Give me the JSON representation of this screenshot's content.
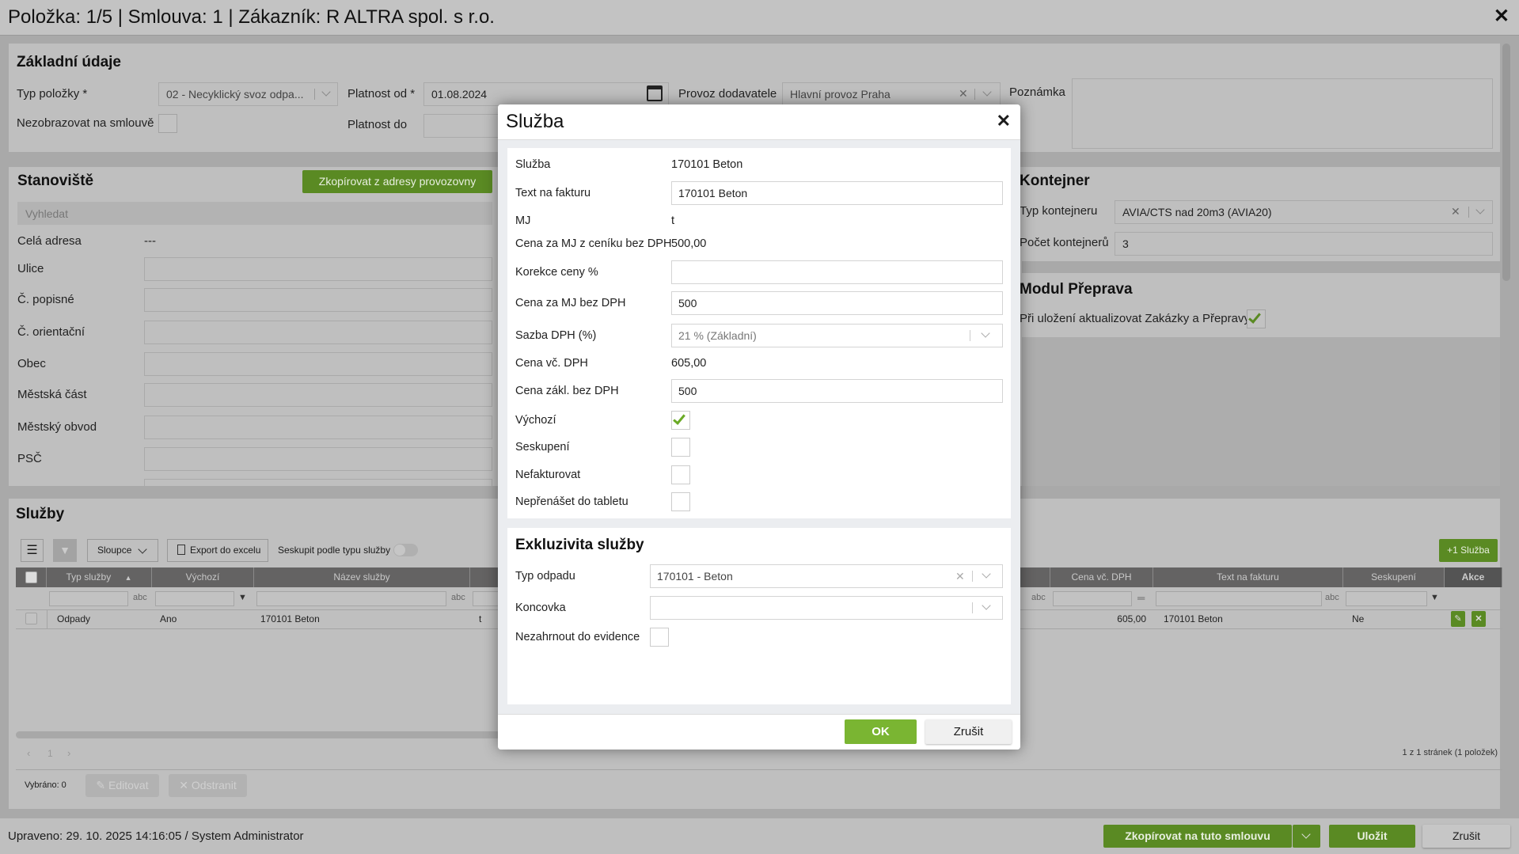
{
  "title": "Položka: 1/5 | Smlouva: 1 | Zákazník: R ALTRA spol. s r.o.",
  "basic": {
    "heading": "Základní údaje",
    "typ_label": "Typ položky *",
    "typ_value": "02 - Necyklický svoz odpa...",
    "nezobrazovat_label": "Nezobrazovat na smlouvě",
    "platnost_od_label": "Platnost od *",
    "platnost_od_value": "01.08.2024",
    "platnost_do_label": "Platnost do",
    "provoz_label": "Provoz dodavatele",
    "provoz_value": "Hlavní provoz Praha",
    "poznamka_label": "Poznámka"
  },
  "stanoviste": {
    "heading": "Stanoviště",
    "copy_button": "Zkopírovat z adresy provozovny",
    "search_placeholder": "Vyhledat",
    "cela_adresa_label": "Celá adresa",
    "cela_adresa_value": "---",
    "fields": [
      "Ulice",
      "Č. popisné",
      "Č. orientační",
      "Obec",
      "Městská část",
      "Městský obvod",
      "PSČ"
    ]
  },
  "kontejner": {
    "heading": "Kontejner",
    "typ_label": "Typ kontejneru",
    "typ_value": "AVIA/CTS nad 20m3 (AVIA20)",
    "pocet_label": "Počet kontejnerů",
    "pocet_value": "3"
  },
  "preprava": {
    "heading": "Modul Přeprava",
    "update_label": "Při uložení aktualizovat Zakázky a Přepravy",
    "update_checked": true
  },
  "sluzby": {
    "heading": "Služby",
    "columns_button": "Sloupce",
    "export_button": "Export do excelu",
    "group_label": "Seskupit podle typu služby",
    "add_button": "+1 Služba",
    "headers": {
      "typ": "Typ služby",
      "vychozi": "Výchozí",
      "nazev": "Název služby",
      "cena_vc": "Cena vč. DPH",
      "text": "Text na fakturu",
      "seskupeni": "Seskupení",
      "akce": "Akce"
    },
    "rows": [
      {
        "typ": "Odpady",
        "vychozi": "Ano",
        "nazev": "170101 Beton",
        "mj": "t",
        "cena_vc": "605,00",
        "text": "170101 Beton",
        "seskupeni": "Ne"
      }
    ],
    "page": "1",
    "page_info": "1 z 1 stránek (1 položek)",
    "selected": "Vybráno: 0",
    "edit_button": "Editovat",
    "delete_button": "Odstranit"
  },
  "footer": {
    "modified": "Upraveno: 29. 10. 2025 14:16:05 / System Administrator",
    "copy_button": "Zkopírovat na tuto smlouvu",
    "save_button": "Uložit",
    "cancel_button": "Zrušit"
  },
  "modal": {
    "title": "Služba",
    "sluzba_label": "Služba",
    "sluzba_value": "170101 Beton",
    "text_label": "Text na fakturu",
    "text_value": "170101 Beton",
    "mj_label": "MJ",
    "mj_value": "t",
    "cenik_label": "Cena za MJ z ceníku bez DPH",
    "cenik_value": "500,00",
    "korekce_label": "Korekce ceny %",
    "korekce_value": "",
    "cena_mj_label": "Cena za MJ bez DPH",
    "cena_mj_value": "500",
    "sazba_label": "Sazba DPH (%)",
    "sazba_value": "21 % (Základní)",
    "cena_vc_label": "Cena vč. DPH",
    "cena_vc_value": "605,00",
    "cena_zakl_label": "Cena zákl. bez DPH",
    "cena_zakl_value": "500",
    "vychozi_label": "Výchozí",
    "seskupeni_label": "Seskupení",
    "nefakturovat_label": "Nefakturovat",
    "neprenaset_label": "Nepřenášet do tabletu",
    "excl_heading": "Exkluzivita služby",
    "typ_odpadu_label": "Typ odpadu",
    "typ_odpadu_value": "170101 - Beton",
    "koncovka_label": "Koncovka",
    "nezahrnout_label": "Nezahrnout do evidence",
    "ok_button": "OK",
    "cancel_button": "Zrušit"
  },
  "colors": {
    "green": "#5a8a23",
    "ok_green": "#7ab532",
    "header": "#646363"
  }
}
